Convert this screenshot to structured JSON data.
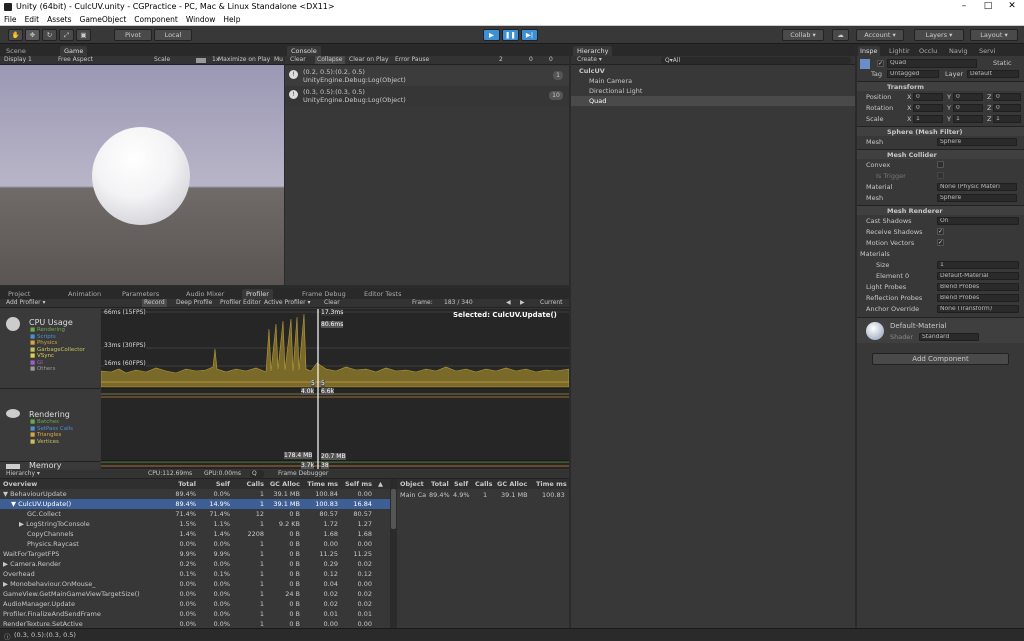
{
  "window": {
    "title": "Unity (64bit) - CulcUV.unity - CGPractice - PC, Mac & Linux Standalone <DX11>",
    "minimize": "–",
    "maximize": "□",
    "close": "✕"
  },
  "menu": [
    "File",
    "Edit",
    "Assets",
    "GameObject",
    "Component",
    "Window",
    "Help"
  ],
  "toolbar": {
    "pivot": "Pivot",
    "local": "Local",
    "collab": "Collab ▾",
    "account": "Account ▾",
    "layers": "Layers ▾",
    "layout": "Layout ▾"
  },
  "scene_tab": "Scene",
  "game_tab": "Game",
  "game": {
    "display": "Display 1",
    "aspect": "Free Aspect",
    "scale": "Scale",
    "scale_val": "1x",
    "maximize": "Maximize on Play",
    "mute": "Mu"
  },
  "console": {
    "tab": "Console",
    "clear": "Clear",
    "collapse": "Collapse",
    "clear_on_play": "Clear on Play",
    "error_pause": "Error Pause",
    "count_log": "2",
    "count_warn": "0",
    "count_err": "0",
    "entries": [
      {
        "line1": "(0.2, 0.5):(0.2, 0.5)",
        "line2": "UnityEngine.Debug:Log(Object)",
        "count": "1"
      },
      {
        "line1": "(0.3, 0.5):(0.3, 0.5)",
        "line2": "UnityEngine.Debug:Log(Object)",
        "count": "10"
      }
    ]
  },
  "hierarchy": {
    "tab": "Hierarchy",
    "create": "Create ▾",
    "search": "Q▾All",
    "root": "CulcUV",
    "items": [
      "Main Camera",
      "Directional Light",
      "Quad"
    ]
  },
  "inspector": {
    "tabs": [
      "Inspe",
      "Lightir",
      "Occlu",
      "Navig",
      "Servi"
    ],
    "object_name": "Quad",
    "static": "Static",
    "tag_label": "Tag",
    "tag": "Untagged",
    "layer_label": "Layer",
    "layer": "Default",
    "transform": {
      "title": "Transform",
      "position": "Position",
      "rotation": "Rotation",
      "scale": "Scale",
      "px": "0",
      "py": "0",
      "pz": "0",
      "rx": "0",
      "ry": "0",
      "rz": "0",
      "sx": "1",
      "sy": "1",
      "sz": "1"
    },
    "mesh_filter": {
      "title": "Sphere (Mesh Filter)",
      "mesh_label": "Mesh",
      "mesh": "Sphere"
    },
    "mesh_collider": {
      "title": "Mesh Collider",
      "convex": "Convex",
      "is_trigger": "Is Trigger",
      "material_label": "Material",
      "material": "None (Physic Materi",
      "mesh_label": "Mesh",
      "mesh": "Sphere"
    },
    "mesh_renderer": {
      "title": "Mesh Renderer",
      "cast_shadows": "Cast Shadows",
      "cast_val": "On",
      "receive": "Receive Shadows",
      "motion": "Motion Vectors",
      "materials": "Materials",
      "size_label": "Size",
      "size": "1",
      "element0": "Element 0",
      "element0_val": "Default-Material",
      "light_probes": "Light Probes",
      "light_val": "Blend Probes",
      "refl_probes": "Reflection Probes",
      "refl_val": "Blend Probes",
      "anchor": "Anchor Override",
      "anchor_val": "None (Transform)"
    },
    "material": {
      "name": "Default-Material",
      "shader_label": "Shader",
      "shader": "Standard"
    },
    "add_component": "Add Component"
  },
  "bottom_tabs": [
    "Project",
    "Animation",
    "Parameters",
    "Audio Mixer",
    "Profiler",
    "Frame Debug",
    "Editor Tests"
  ],
  "profiler": {
    "add": "Add Profiler ▾",
    "record": "Record",
    "deep": "Deep Profile",
    "editor": "Profiler Editor",
    "active": "Active Profiler ▾",
    "clear": "Clear",
    "frame_label": "Frame:",
    "frame": "183 / 340",
    "current": "Current",
    "selected": "Selected: CulcUV.Update()",
    "fps66": "66ms (15FPS)",
    "fps33": "33ms (30FPS)",
    "fps16": "16ms (60FPS)",
    "ms_top": "17.3ms",
    "ms2": "80.6ms",
    "val5a": "5",
    "val5b": "5",
    "val4k": "4.0k",
    "val6k": "6.6k",
    "mem1": "178.4 MB",
    "mem2": "20.7 MB",
    "mem3": "38",
    "mem4": "3.7k",
    "cpu": {
      "title": "CPU Usage",
      "legend": [
        "Rendering",
        "Scripts",
        "Physics",
        "GarbageCollector",
        "VSync",
        "GI",
        "Others"
      ]
    },
    "rendering": {
      "title": "Rendering",
      "legend": [
        "Batches",
        "SetPass Calls",
        "Triangles",
        "Vertices"
      ]
    },
    "memory": {
      "title": "Memory"
    },
    "bottom": {
      "hier": "Hierarchy ▾",
      "cpu": "CPU:112.69ms",
      "gpu": "GPU:0.00ms",
      "search": "Q",
      "frame_debugger": "Frame Debugger"
    },
    "columns": [
      "Overview",
      "Total",
      "Self",
      "Calls",
      "GC Alloc",
      "Time ms",
      "Self ms",
      "▲"
    ],
    "rows": [
      {
        "name": "▼ BehaviourUpdate",
        "total": "89.4%",
        "self": "0.0%",
        "calls": "1",
        "gc": "39.1 MB",
        "time": "100.84",
        "selfms": "0.00",
        "indent": 0
      },
      {
        "name": "▼ CulcUV.Update()",
        "total": "89.4%",
        "self": "14.9%",
        "calls": "1",
        "gc": "39.1 MB",
        "time": "100.83",
        "selfms": "16.84",
        "indent": 1
      },
      {
        "name": "GC.Collect",
        "total": "71.4%",
        "self": "71.4%",
        "calls": "12",
        "gc": "0 B",
        "time": "80.57",
        "selfms": "80.57",
        "indent": 3
      },
      {
        "name": "▶ LogStringToConsole",
        "total": "1.5%",
        "self": "1.1%",
        "calls": "1",
        "gc": "9.2 KB",
        "time": "1.72",
        "selfms": "1.27",
        "indent": 2
      },
      {
        "name": "CopyChannels",
        "total": "1.4%",
        "self": "1.4%",
        "calls": "2208",
        "gc": "0 B",
        "time": "1.68",
        "selfms": "1.68",
        "indent": 3
      },
      {
        "name": "Physics.Raycast",
        "total": "0.0%",
        "self": "0.0%",
        "calls": "1",
        "gc": "0 B",
        "time": "0.00",
        "selfms": "0.00",
        "indent": 3
      },
      {
        "name": "WaitForTargetFPS",
        "total": "9.9%",
        "self": "9.9%",
        "calls": "1",
        "gc": "0 B",
        "time": "11.25",
        "selfms": "11.25",
        "indent": 0
      },
      {
        "name": "▶ Camera.Render",
        "total": "0.2%",
        "self": "0.0%",
        "calls": "1",
        "gc": "0 B",
        "time": "0.29",
        "selfms": "0.02",
        "indent": 0
      },
      {
        "name": "Overhead",
        "total": "0.1%",
        "self": "0.1%",
        "calls": "1",
        "gc": "0 B",
        "time": "0.12",
        "selfms": "0.12",
        "indent": 0
      },
      {
        "name": "▶ Monobehaviour.OnMouse_",
        "total": "0.0%",
        "self": "0.0%",
        "calls": "1",
        "gc": "0 B",
        "time": "0.04",
        "selfms": "0.00",
        "indent": 0
      },
      {
        "name": "GameView.GetMainGameViewTargetSize()",
        "total": "0.0%",
        "self": "0.0%",
        "calls": "1",
        "gc": "24 B",
        "time": "0.02",
        "selfms": "0.02",
        "indent": 0
      },
      {
        "name": "AudioManager.Update",
        "total": "0.0%",
        "self": "0.0%",
        "calls": "1",
        "gc": "0 B",
        "time": "0.02",
        "selfms": "0.02",
        "indent": 0
      },
      {
        "name": "Profiler.FinalizeAndSendFrame",
        "total": "0.0%",
        "self": "0.0%",
        "calls": "1",
        "gc": "0 B",
        "time": "0.01",
        "selfms": "0.01",
        "indent": 0
      },
      {
        "name": "RenderTexture.SetActive",
        "total": "0.0%",
        "self": "0.0%",
        "calls": "1",
        "gc": "0 B",
        "time": "0.00",
        "selfms": "0.00",
        "indent": 0
      }
    ],
    "detail_columns": [
      "Object",
      "Total",
      "Self",
      "Calls",
      "GC Alloc",
      "Time ms"
    ],
    "detail_row": {
      "object": "Main Ca",
      "total": "89.4%",
      "self": "4.9%",
      "calls": "1",
      "gc": "39.1 MB",
      "time": "100.83"
    }
  },
  "statusbar": "(0.3, 0.5):(0.3, 0.5)",
  "colors": {
    "accent": "#3e5f96",
    "cpu_graph": "#7a6a2a",
    "play": "#3d8fd6"
  }
}
